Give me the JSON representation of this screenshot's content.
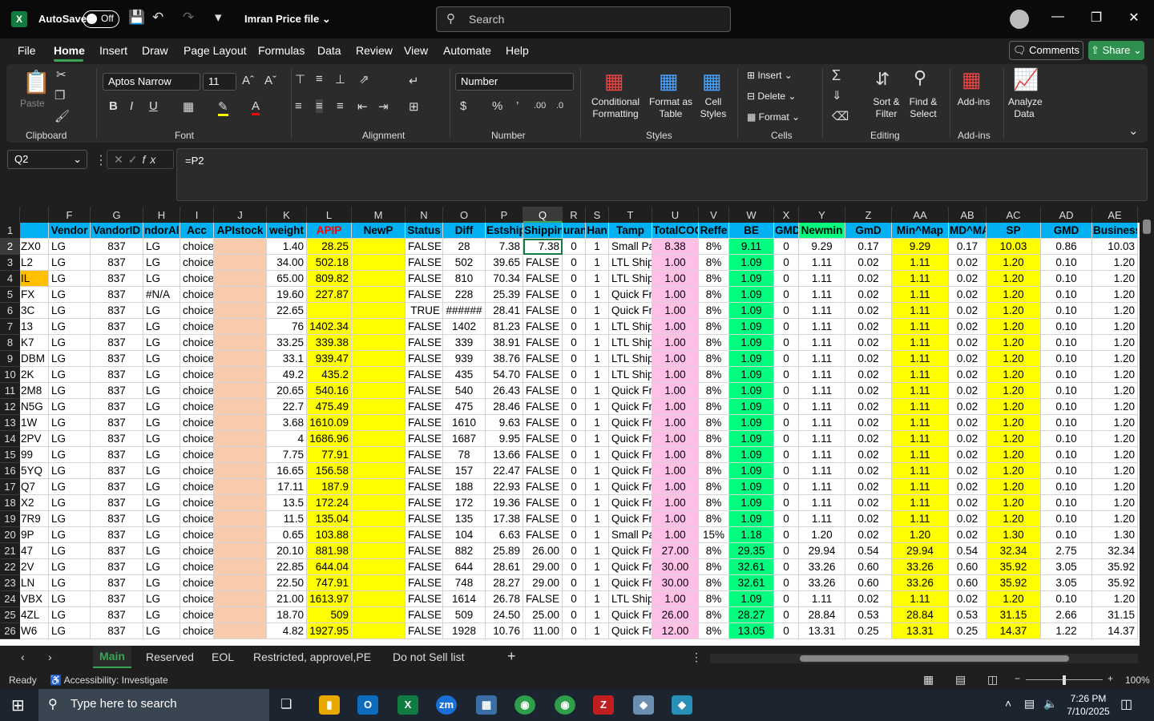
{
  "titlebar": {
    "autosave": "AutoSave",
    "toggle": "Off",
    "filename": "Imran Price file",
    "search_placeholder": "Search"
  },
  "menu": [
    "File",
    "Home",
    "Insert",
    "Draw",
    "Page Layout",
    "Formulas",
    "Data",
    "Review",
    "View",
    "Automate",
    "Help"
  ],
  "comments": "Comments",
  "share": "Share",
  "ribbon": {
    "paste": "Paste",
    "clipboard": "Clipboard",
    "font_name": "Aptos Narrow",
    "font_size": "11",
    "font": "Font",
    "alignment": "Alignment",
    "number_format": "Number",
    "number": "Number",
    "conditional": "Conditional Formatting",
    "format_table": "Format as Table",
    "cell_styles": "Cell Styles",
    "styles": "Styles",
    "insert": "Insert",
    "delete": "Delete",
    "format": "Format",
    "cells": "Cells",
    "sort": "Sort & Filter",
    "find": "Find & Select",
    "editing": "Editing",
    "addins": "Add-ins",
    "addins_group": "Add-ins",
    "analyze": "Analyze Data"
  },
  "formula_bar": {
    "name_box": "Q2",
    "formula": "=P2"
  },
  "columns": [
    {
      "letter": "F",
      "w": 52,
      "head": "Vendor",
      "align": "l",
      "bg": ""
    },
    {
      "letter": "G",
      "w": 66,
      "head": "VandorID",
      "align": "c",
      "bg": ""
    },
    {
      "letter": "H",
      "w": 46,
      "head": "ndorAll",
      "align": "l",
      "bg": ""
    },
    {
      "letter": "I",
      "w": 42,
      "head": "Acc",
      "align": "l",
      "bg": ""
    },
    {
      "letter": "J",
      "w": 66,
      "head": "APIstock",
      "align": "r",
      "bg": "#f8cbad"
    },
    {
      "letter": "K",
      "w": 50,
      "head": "weight",
      "align": "r",
      "bg": ""
    },
    {
      "letter": "L",
      "w": 56,
      "head": "APIP",
      "align": "r",
      "bg": "#ffff00",
      "headColor": "#ff0000"
    },
    {
      "letter": "M",
      "w": 67,
      "head": "NewP",
      "align": "r",
      "bg": "#ffff00"
    },
    {
      "letter": "N",
      "w": 47,
      "head": "Status",
      "align": "r",
      "bg": ""
    },
    {
      "letter": "O",
      "w": 53,
      "head": "Diff",
      "align": "c",
      "bg": ""
    },
    {
      "letter": "P",
      "w": 47,
      "head": "Estship",
      "align": "r",
      "bg": ""
    },
    {
      "letter": "Q",
      "w": 49,
      "head": "Shippin",
      "align": "r",
      "bg": ""
    },
    {
      "letter": "R",
      "w": 29,
      "head": "uran",
      "align": "c",
      "bg": ""
    },
    {
      "letter": "S",
      "w": 29,
      "head": "Han",
      "align": "c",
      "bg": ""
    },
    {
      "letter": "T",
      "w": 54,
      "head": "Tamp",
      "align": "l",
      "bg": ""
    },
    {
      "letter": "U",
      "w": 58,
      "head": "TotalCOG",
      "align": "c",
      "bg": "#ffc0e8"
    },
    {
      "letter": "V",
      "w": 38,
      "head": "Reffe",
      "align": "c",
      "bg": ""
    },
    {
      "letter": "W",
      "w": 56,
      "head": "BE",
      "align": "c",
      "bg": "#00ff7f"
    },
    {
      "letter": "X",
      "w": 31,
      "head": "GMD",
      "align": "c",
      "bg": ""
    },
    {
      "letter": "Y",
      "w": 58,
      "head": "Newmin",
      "align": "c",
      "bg": "",
      "headBg": "#00ff7f"
    },
    {
      "letter": "Z",
      "w": 58,
      "head": "GmD",
      "align": "c",
      "bg": ""
    },
    {
      "letter": "AA",
      "w": 71,
      "head": "Min^Map",
      "align": "c",
      "bg": "#ffff00"
    },
    {
      "letter": "AB",
      "w": 47,
      "head": "MD^MA",
      "align": "c",
      "bg": ""
    },
    {
      "letter": "AC",
      "w": 68,
      "head": "SP",
      "align": "c",
      "bg": "#ffff00"
    },
    {
      "letter": "AD",
      "w": 64,
      "head": "GMD",
      "align": "c",
      "bg": ""
    },
    {
      "letter": "AE",
      "w": 57,
      "head": "Business",
      "align": "r",
      "bg": ""
    }
  ],
  "rows": [
    [
      "ZX0",
      "LG",
      "837",
      "LG",
      "choice",
      "",
      "1.40",
      "28.25",
      "",
      "FALSE",
      "28",
      "7.38",
      "7.38",
      "0",
      "1",
      "Small Pa",
      "8.38",
      "8%",
      "9.11",
      "0",
      "9.29",
      "0.17",
      "9.29",
      "0.17",
      "10.03",
      "0.86",
      "10.03"
    ],
    [
      "L2",
      "LG",
      "837",
      "LG",
      "choice",
      "",
      "34.00",
      "502.18",
      "",
      "FALSE",
      "502",
      "39.65",
      "FALSE",
      "0",
      "1",
      "LTL Ship",
      "1.00",
      "8%",
      "1.09",
      "0",
      "1.11",
      "0.02",
      "1.11",
      "0.02",
      "1.20",
      "0.10",
      "1.20"
    ],
    [
      "IL",
      "LG",
      "837",
      "LG",
      "choice",
      "",
      "65.00",
      "809.82",
      "",
      "FALSE",
      "810",
      "70.34",
      "FALSE",
      "0",
      "1",
      "LTL Ship",
      "1.00",
      "8%",
      "1.09",
      "0",
      "1.11",
      "0.02",
      "1.11",
      "0.02",
      "1.20",
      "0.10",
      "1.20"
    ],
    [
      "FX",
      "LG",
      "837",
      "#N/A",
      "choice",
      "",
      "19.60",
      "227.87",
      "",
      "FALSE",
      "228",
      "25.39",
      "FALSE",
      "0",
      "1",
      "Quick Fr",
      "1.00",
      "8%",
      "1.09",
      "0",
      "1.11",
      "0.02",
      "1.11",
      "0.02",
      "1.20",
      "0.10",
      "1.20"
    ],
    [
      "3C",
      "LG",
      "837",
      "LG",
      "choice",
      "",
      "22.65",
      "",
      "",
      "TRUE",
      "######",
      "28.41",
      "FALSE",
      "0",
      "1",
      "Quick Fr",
      "1.00",
      "8%",
      "1.09",
      "0",
      "1.11",
      "0.02",
      "1.11",
      "0.02",
      "1.20",
      "0.10",
      "1.20"
    ],
    [
      "13",
      "LG",
      "837",
      "LG",
      "choice",
      "",
      "76",
      "1402.34",
      "",
      "FALSE",
      "1402",
      "81.23",
      "FALSE",
      "0",
      "1",
      "LTL Ship",
      "1.00",
      "8%",
      "1.09",
      "0",
      "1.11",
      "0.02",
      "1.11",
      "0.02",
      "1.20",
      "0.10",
      "1.20"
    ],
    [
      "K7",
      "LG",
      "837",
      "LG",
      "choice",
      "",
      "33.25",
      "339.38",
      "",
      "FALSE",
      "339",
      "38.91",
      "FALSE",
      "0",
      "1",
      "LTL Ship",
      "1.00",
      "8%",
      "1.09",
      "0",
      "1.11",
      "0.02",
      "1.11",
      "0.02",
      "1.20",
      "0.10",
      "1.20"
    ],
    [
      "DBM",
      "LG",
      "837",
      "LG",
      "choice",
      "",
      "33.1",
      "939.47",
      "",
      "FALSE",
      "939",
      "38.76",
      "FALSE",
      "0",
      "1",
      "LTL Ship",
      "1.00",
      "8%",
      "1.09",
      "0",
      "1.11",
      "0.02",
      "1.11",
      "0.02",
      "1.20",
      "0.10",
      "1.20"
    ],
    [
      "2K",
      "LG",
      "837",
      "LG",
      "choice",
      "",
      "49.2",
      "435.2",
      "",
      "FALSE",
      "435",
      "54.70",
      "FALSE",
      "0",
      "1",
      "LTL Ship",
      "1.00",
      "8%",
      "1.09",
      "0",
      "1.11",
      "0.02",
      "1.11",
      "0.02",
      "1.20",
      "0.10",
      "1.20"
    ],
    [
      "2M8",
      "LG",
      "837",
      "LG",
      "choice",
      "",
      "20.65",
      "540.16",
      "",
      "FALSE",
      "540",
      "26.43",
      "FALSE",
      "0",
      "1",
      "Quick Fr",
      "1.00",
      "8%",
      "1.09",
      "0",
      "1.11",
      "0.02",
      "1.11",
      "0.02",
      "1.20",
      "0.10",
      "1.20"
    ],
    [
      "N5G",
      "LG",
      "837",
      "LG",
      "choice",
      "",
      "22.7",
      "475.49",
      "",
      "FALSE",
      "475",
      "28.46",
      "FALSE",
      "0",
      "1",
      "Quick Fr",
      "1.00",
      "8%",
      "1.09",
      "0",
      "1.11",
      "0.02",
      "1.11",
      "0.02",
      "1.20",
      "0.10",
      "1.20"
    ],
    [
      "1W",
      "LG",
      "837",
      "LG",
      "choice",
      "",
      "3.68",
      "1610.09",
      "",
      "FALSE",
      "1610",
      "9.63",
      "FALSE",
      "0",
      "1",
      "Quick Fr",
      "1.00",
      "8%",
      "1.09",
      "0",
      "1.11",
      "0.02",
      "1.11",
      "0.02",
      "1.20",
      "0.10",
      "1.20"
    ],
    [
      "2PV",
      "LG",
      "837",
      "LG",
      "choice",
      "",
      "4",
      "1686.96",
      "",
      "FALSE",
      "1687",
      "9.95",
      "FALSE",
      "0",
      "1",
      "Quick Fr",
      "1.00",
      "8%",
      "1.09",
      "0",
      "1.11",
      "0.02",
      "1.11",
      "0.02",
      "1.20",
      "0.10",
      "1.20"
    ],
    [
      "99",
      "LG",
      "837",
      "LG",
      "choice",
      "",
      "7.75",
      "77.91",
      "",
      "FALSE",
      "78",
      "13.66",
      "FALSE",
      "0",
      "1",
      "Quick Fr",
      "1.00",
      "8%",
      "1.09",
      "0",
      "1.11",
      "0.02",
      "1.11",
      "0.02",
      "1.20",
      "0.10",
      "1.20"
    ],
    [
      "5YQ",
      "LG",
      "837",
      "LG",
      "choice",
      "",
      "16.65",
      "156.58",
      "",
      "FALSE",
      "157",
      "22.47",
      "FALSE",
      "0",
      "1",
      "Quick Fr",
      "1.00",
      "8%",
      "1.09",
      "0",
      "1.11",
      "0.02",
      "1.11",
      "0.02",
      "1.20",
      "0.10",
      "1.20"
    ],
    [
      "Q7",
      "LG",
      "837",
      "LG",
      "choice",
      "",
      "17.11",
      "187.9",
      "",
      "FALSE",
      "188",
      "22.93",
      "FALSE",
      "0",
      "1",
      "Quick Fr",
      "1.00",
      "8%",
      "1.09",
      "0",
      "1.11",
      "0.02",
      "1.11",
      "0.02",
      "1.20",
      "0.10",
      "1.20"
    ],
    [
      "X2",
      "LG",
      "837",
      "LG",
      "choice",
      "",
      "13.5",
      "172.24",
      "",
      "FALSE",
      "172",
      "19.36",
      "FALSE",
      "0",
      "1",
      "Quick Fr",
      "1.00",
      "8%",
      "1.09",
      "0",
      "1.11",
      "0.02",
      "1.11",
      "0.02",
      "1.20",
      "0.10",
      "1.20"
    ],
    [
      "7R9",
      "LG",
      "837",
      "LG",
      "choice",
      "",
      "11.5",
      "135.04",
      "",
      "FALSE",
      "135",
      "17.38",
      "FALSE",
      "0",
      "1",
      "Quick Fr",
      "1.00",
      "8%",
      "1.09",
      "0",
      "1.11",
      "0.02",
      "1.11",
      "0.02",
      "1.20",
      "0.10",
      "1.20"
    ],
    [
      "9P",
      "LG",
      "837",
      "LG",
      "choice",
      "",
      "0.65",
      "103.88",
      "",
      "FALSE",
      "104",
      "6.63",
      "FALSE",
      "0",
      "1",
      "Small Pa",
      "1.00",
      "15%",
      "1.18",
      "0",
      "1.20",
      "0.02",
      "1.20",
      "0.02",
      "1.30",
      "0.10",
      "1.30"
    ],
    [
      "47",
      "LG",
      "837",
      "LG",
      "choice",
      "",
      "20.10",
      "881.98",
      "",
      "FALSE",
      "882",
      "25.89",
      "26.00",
      "0",
      "1",
      "Quick Fr",
      "27.00",
      "8%",
      "29.35",
      "0",
      "29.94",
      "0.54",
      "29.94",
      "0.54",
      "32.34",
      "2.75",
      "32.34"
    ],
    [
      "2V",
      "LG",
      "837",
      "LG",
      "choice",
      "",
      "22.85",
      "644.04",
      "",
      "FALSE",
      "644",
      "28.61",
      "29.00",
      "0",
      "1",
      "Quick Fr",
      "30.00",
      "8%",
      "32.61",
      "0",
      "33.26",
      "0.60",
      "33.26",
      "0.60",
      "35.92",
      "3.05",
      "35.92"
    ],
    [
      "LN",
      "LG",
      "837",
      "LG",
      "choice",
      "",
      "22.50",
      "747.91",
      "",
      "FALSE",
      "748",
      "28.27",
      "29.00",
      "0",
      "1",
      "Quick Fr",
      "30.00",
      "8%",
      "32.61",
      "0",
      "33.26",
      "0.60",
      "33.26",
      "0.60",
      "35.92",
      "3.05",
      "35.92"
    ],
    [
      "VBX",
      "LG",
      "837",
      "LG",
      "choice",
      "",
      "21.00",
      "1613.97",
      "",
      "FALSE",
      "1614",
      "26.78",
      "FALSE",
      "0",
      "1",
      "LTL Ship",
      "1.00",
      "8%",
      "1.09",
      "0",
      "1.11",
      "0.02",
      "1.11",
      "0.02",
      "1.20",
      "0.10",
      "1.20"
    ],
    [
      "4ZL",
      "LG",
      "837",
      "LG",
      "choice",
      "",
      "18.70",
      "509",
      "",
      "FALSE",
      "509",
      "24.50",
      "25.00",
      "0",
      "1",
      "Quick Fr",
      "26.00",
      "8%",
      "28.27",
      "0",
      "28.84",
      "0.53",
      "28.84",
      "0.53",
      "31.15",
      "2.66",
      "31.15"
    ],
    [
      "W6",
      "LG",
      "837",
      "LG",
      "choice",
      "",
      "4.82",
      "1927.95",
      "",
      "FALSE",
      "1928",
      "10.76",
      "11.00",
      "0",
      "1",
      "Quick Fr",
      "12.00",
      "8%",
      "13.05",
      "0",
      "13.31",
      "0.25",
      "13.31",
      "0.25",
      "14.37",
      "1.22",
      "14.37"
    ]
  ],
  "selected_cell": "Q2",
  "sheets": [
    "Main",
    "Reserved",
    "EOL",
    "Restricted, approvel,PE",
    "Do not Sell list"
  ],
  "status": {
    "ready": "Ready",
    "accessibility": "Accessibility: Investigate",
    "zoom": "100%"
  },
  "taskbar": {
    "search_placeholder": "Type here to search",
    "time": "7:26 PM",
    "date": "7/10/2025"
  }
}
